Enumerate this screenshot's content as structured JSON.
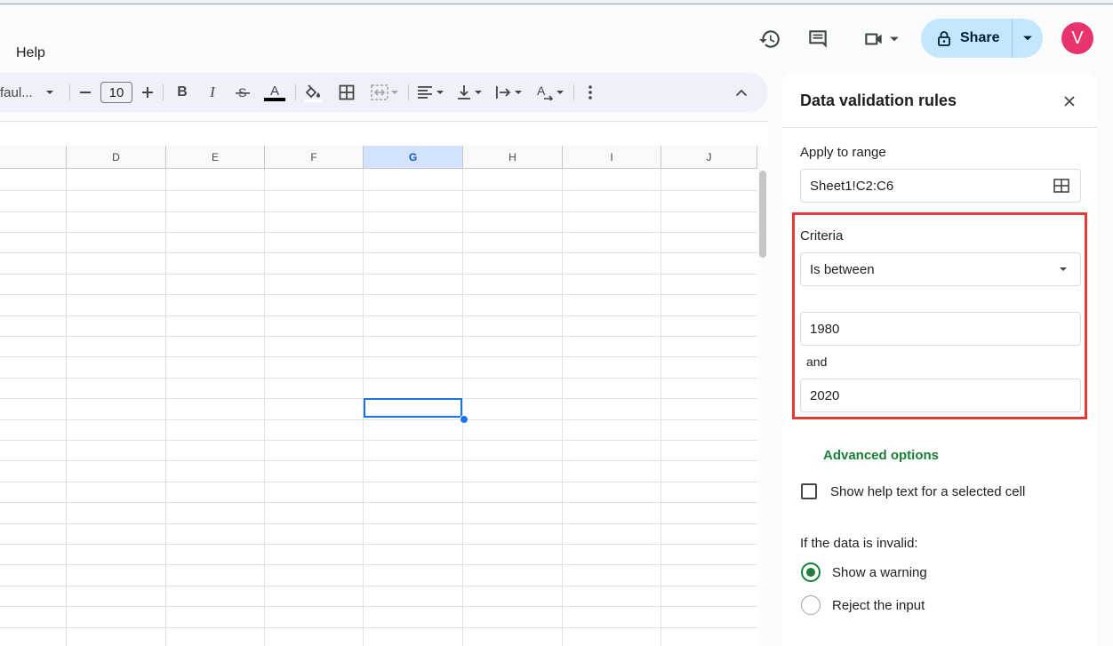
{
  "menu": {
    "help": "Help"
  },
  "header": {
    "share_label": "Share",
    "avatar_initial": "V"
  },
  "toolbar": {
    "font_name": "faul...",
    "font_size": "10",
    "text_color": "#000000"
  },
  "grid": {
    "columns": [
      "D",
      "E",
      "F",
      "G",
      "H",
      "I",
      "J"
    ],
    "selected_column": "G"
  },
  "panel": {
    "title": "Data validation rules",
    "apply_to_range_label": "Apply to range",
    "range_value": "Sheet1!C2:C6",
    "criteria_label": "Criteria",
    "criteria_value": "Is between",
    "min_value": "1980",
    "and_label": "and",
    "max_value": "2020",
    "advanced_options": "Advanced options",
    "help_text_checkbox": "Show help text for a selected cell",
    "invalid_label": "If the data is invalid:",
    "option_warning": "Show a warning",
    "option_reject": "Reject the input",
    "selected_option": "Show a warning"
  },
  "colors": {
    "accent_green": "#188038",
    "highlight_red": "#e53935",
    "share_bg": "#c2e7ff",
    "avatar_bg": "#e8336c",
    "selection_blue": "#1a73e8"
  }
}
